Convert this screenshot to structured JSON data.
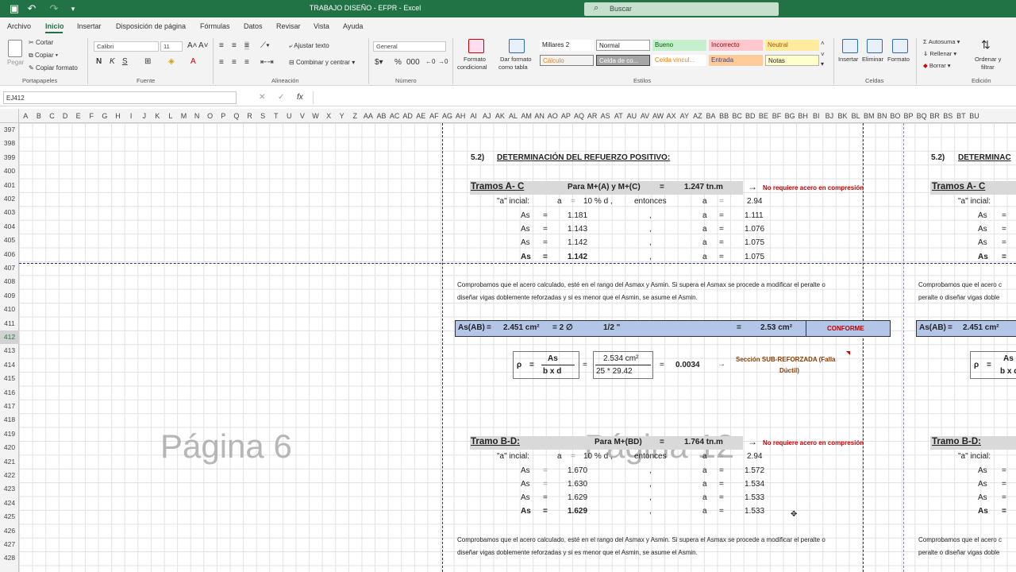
{
  "window": {
    "title": "TRABAJO DISEÑO - EFPR - Excel",
    "search_placeholder": "Buscar"
  },
  "menu": [
    "Archivo",
    "Inicio",
    "Insertar",
    "Disposición de página",
    "Fórmulas",
    "Datos",
    "Revisar",
    "Vista",
    "Ayuda"
  ],
  "ribbon": {
    "paste": "Pegar",
    "cut": "Cortar",
    "copy": "Copiar",
    "format_painter": "Copiar formato",
    "clipboard_group": "Portapapeles",
    "font_name": "Calibri",
    "font_size": "11",
    "font_group": "Fuente",
    "wrap_text": "Ajustar texto",
    "merge_center": "Combinar y centrar",
    "alignment_group": "Alineación",
    "number_format": "General",
    "number_group": "Número",
    "conditional_format": "Formato",
    "conditional_format2": "condicional",
    "format_table": "Dar formato",
    "format_table2": "como tabla",
    "styles": [
      "Millares 2",
      "Normal",
      "Bueno",
      "Incorrecto",
      "Neutral",
      "Cálculo",
      "Celda de co...",
      "Celda vincul...",
      "Entrada",
      "Notas"
    ],
    "styles_group": "Estilos",
    "insert": "Insertar",
    "delete": "Eliminar",
    "format": "Formato",
    "cells_group": "Celdas",
    "autosum": "Autosuma",
    "fill": "Rellenar",
    "clear": "Borrar",
    "sort_filter": "Ordenar y",
    "sort_filter2": "filtrar",
    "editing_group": "Edición"
  },
  "formula_bar": {
    "name_box": "EJ412",
    "fx": "fx",
    "content": ""
  },
  "columns": [
    "A",
    "B",
    "C",
    "D",
    "E",
    "F",
    "G",
    "H",
    "I",
    "J",
    "K",
    "L",
    "M",
    "N",
    "O",
    "P",
    "Q",
    "R",
    "S",
    "T",
    "U",
    "V",
    "W",
    "X",
    "Y",
    "Z",
    "AA",
    "AB",
    "AC",
    "AD",
    "AE",
    "AF",
    "AG",
    "AH",
    "AI",
    "AJ",
    "AK",
    "AL",
    "AM",
    "AN",
    "AO",
    "AP",
    "AQ",
    "AR",
    "AS",
    "AT",
    "AU",
    "AV",
    "AW",
    "AX",
    "AY",
    "AZ",
    "BA",
    "BB",
    "BC",
    "BD",
    "BE",
    "BF",
    "BG",
    "BH",
    "BI",
    "BJ",
    "BK",
    "BL",
    "BM",
    "BN",
    "BO",
    "BP",
    "BQ",
    "BR",
    "BS",
    "BT",
    "BU"
  ],
  "rows": [
    "397",
    "398",
    "399",
    "400",
    "401",
    "402",
    "403",
    "404",
    "405",
    "406",
    "407",
    "408",
    "409",
    "410",
    "411",
    "412",
    "413",
    "414",
    "415",
    "416",
    "417",
    "418",
    "419",
    "420",
    "421",
    "422",
    "423",
    "424",
    "425",
    "426",
    "427",
    "428"
  ],
  "selected_row": "412",
  "watermarks": [
    "Página 6",
    "Página 12"
  ],
  "sheet": {
    "section_title": "5.2)",
    "section_text": "DETERMINACIÓN DEL REFUERZO POSITIVO:",
    "section_text_cut": "DETERMINAC",
    "tramo_ac": "Tramos A- C",
    "para_ac": "Para M+(A) y M+(C)",
    "eq": "=",
    "moment_ac": "1.247 tn.m",
    "arrow": "→",
    "no_req": "No requiere acero en compresión",
    "a_inicial": "\"a\" incial:",
    "a": "a",
    "pct": "10 %  d ,",
    "entonces": "entonces",
    "a_init_val": "2.94",
    "as": "As",
    "comma": ",",
    "ac_rows": [
      {
        "as": "1.181",
        "a": "1.111"
      },
      {
        "as": "1.143",
        "a": "1.076"
      },
      {
        "as": "1.142",
        "a": "1.075"
      },
      {
        "as": "1.142",
        "a": "1.075"
      }
    ],
    "check_line1": "Comprobamos que el acero calculado, esté en el rango del Asmax y Asmin. Si supera el Asmax se procede a modificar el peralte o",
    "check_line2": "diseñar vigas doblemente reforzadas y si es menor que el Asmin, se asume el Asmin.",
    "check_cut1": "Comprobamos que el acero c",
    "check_cut2": "peralte o diseñar vigas doble",
    "as_ab": "As(AB)",
    "as_ab_val": "2.451 cm²",
    "eq2": "=   2   ∅",
    "bar": "1/2 \"",
    "as_prov": "2.53 cm²",
    "conforme": "CONFORME",
    "rho": "ρ",
    "rho_num": "As",
    "rho_den": "b x d",
    "rho_num_val": "2.534 cm²",
    "rho_den_val": "25  *   29.42",
    "rho_val": "0.0034",
    "seccion": "Sección SUB-REFORZADA (Falla",
    "seccion2": "Dúctil)",
    "tramo_bd": "Tramo B-D:",
    "para_bd": "Para M+(BD)",
    "moment_bd": "1.764 tn.m",
    "bd_rows": [
      {
        "as": "1.670",
        "a": "1.572"
      },
      {
        "as": "1.630",
        "a": "1.534"
      },
      {
        "as": "1.629",
        "a": "1.533"
      },
      {
        "as": "1.629",
        "a": "1.533"
      }
    ]
  }
}
